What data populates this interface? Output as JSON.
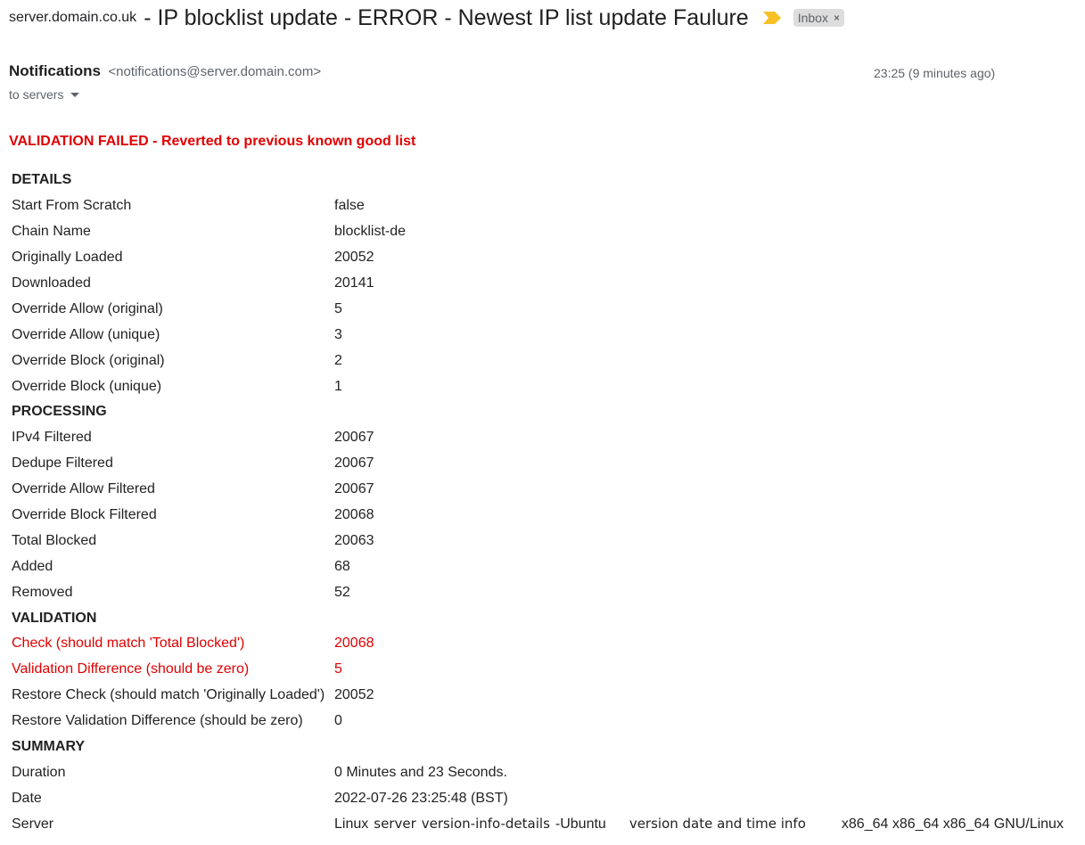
{
  "email": {
    "subject_sender": "server.domain.co.uk",
    "subject": " - IP blocklist update - ERROR - Newest IP list update Faulure",
    "label_chip": "Inbox",
    "label_chip_close": "×",
    "sender_name": "Notifications",
    "sender_email": "<notifications@server.domain.com>",
    "timestamp": "23:25 (9 minutes ago)",
    "recipients": "to servers",
    "important_color": "#f6c026"
  },
  "body": {
    "alert": "VALIDATION FAILED - Reverted to previous known good list",
    "alert_color": "#e00000",
    "rows": [
      {
        "key": "DETAILS",
        "value": "",
        "type": "section"
      },
      {
        "key": "Start From Scratch",
        "value": "false",
        "type": "normal"
      },
      {
        "key": "Chain Name",
        "value": "blocklist-de",
        "type": "normal"
      },
      {
        "key": "Originally Loaded",
        "value": "20052",
        "type": "normal"
      },
      {
        "key": "Downloaded",
        "value": "20141",
        "type": "normal"
      },
      {
        "key": "Override Allow (original)",
        "value": "5",
        "type": "normal"
      },
      {
        "key": "Override Allow (unique)",
        "value": "3",
        "type": "normal"
      },
      {
        "key": "Override Block (original)",
        "value": "2",
        "type": "normal"
      },
      {
        "key": "Override Block (unique)",
        "value": "1",
        "type": "normal"
      },
      {
        "key": "PROCESSING",
        "value": "",
        "type": "section"
      },
      {
        "key": "IPv4 Filtered",
        "value": "20067",
        "type": "normal"
      },
      {
        "key": "Dedupe Filtered",
        "value": "20067",
        "type": "normal"
      },
      {
        "key": "Override Allow Filtered",
        "value": "20067",
        "type": "normal"
      },
      {
        "key": "Override Block Filtered",
        "value": "20068",
        "type": "normal"
      },
      {
        "key": "Total Blocked",
        "value": "20063",
        "type": "normal"
      },
      {
        "key": "Added",
        "value": "68",
        "type": "normal"
      },
      {
        "key": "Removed",
        "value": "52",
        "type": "normal"
      },
      {
        "key": "VALIDATION",
        "value": "",
        "type": "section"
      },
      {
        "key": "Check (should match 'Total Blocked')",
        "value": "20068",
        "type": "error"
      },
      {
        "key": "Validation Difference (should be zero)",
        "value": "5",
        "type": "error"
      },
      {
        "key": "Restore Check (should match 'Originally Loaded')",
        "value": "20052",
        "type": "normal"
      },
      {
        "key": "Restore Validation Difference (should be zero)",
        "value": "0",
        "type": "normal"
      },
      {
        "key": "SUMMARY",
        "value": "",
        "type": "section"
      },
      {
        "key": "Duration",
        "value": "0 Minutes and 23 Seconds.",
        "type": "normal"
      },
      {
        "key": "Date",
        "value": "2022-07-26 23:25:48 (BST)",
        "type": "normal"
      }
    ],
    "server_row": {
      "key": "Server",
      "parts": [
        "Linux",
        "server",
        "version-info-details",
        "-Ubuntu",
        "version date and time info",
        "x86_64 x86_64 x86_64 GNU/Linux"
      ]
    }
  }
}
